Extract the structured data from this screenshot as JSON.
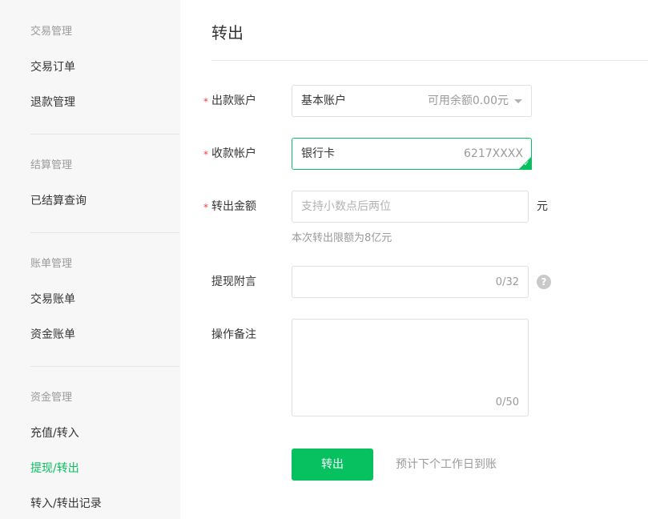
{
  "sidebar": {
    "groups": [
      {
        "title": "交易管理",
        "items": [
          "交易订单",
          "退款管理"
        ]
      },
      {
        "title": "结算管理",
        "items": [
          "已结算查询"
        ]
      },
      {
        "title": "账单管理",
        "items": [
          "交易账单",
          "资金账单"
        ]
      },
      {
        "title": "资金管理",
        "items": [
          "充值/转入",
          "提现/转出",
          "转入/转出记录"
        ]
      }
    ],
    "active_item": "提现/转出"
  },
  "page": {
    "title": "转出"
  },
  "form": {
    "required_mark": "*",
    "source_account": {
      "label": "出款账户",
      "value": "基本账户",
      "balance": "可用余额0.00元"
    },
    "payee_account": {
      "label": "收款帐户",
      "value": "银行卡",
      "number": "6217XXXX"
    },
    "amount": {
      "label": "转出金额",
      "placeholder": "支持小数点后两位",
      "unit": "元",
      "hint": "本次转出限额为8亿元"
    },
    "withdraw_note": {
      "label": "提现附言",
      "value": "",
      "counter": "0/32",
      "help": "?"
    },
    "remark": {
      "label": "操作备注",
      "value": "",
      "counter": "0/50"
    },
    "submit": {
      "label": "转出",
      "hint": "预计下个工作日到账"
    }
  },
  "colors": {
    "accent": "#07c160",
    "required": "#e64340",
    "muted": "#9a9a9a"
  }
}
